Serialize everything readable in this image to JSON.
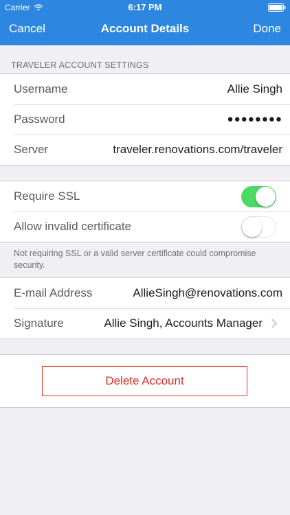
{
  "status_bar": {
    "carrier": "Carrier",
    "time": "6:17 PM"
  },
  "nav": {
    "cancel_label": "Cancel",
    "title": "Account Details",
    "done_label": "Done"
  },
  "traveler_section": {
    "header": "TRAVELER ACCOUNT SETTINGS",
    "rows": [
      {
        "label": "Username",
        "value": "Allie Singh"
      },
      {
        "label": "Password",
        "value": "●●●●●●●●"
      },
      {
        "label": "Server",
        "value": "traveler.renovations.com/traveler"
      }
    ]
  },
  "ssl_section": {
    "require_ssl": {
      "label": "Require SSL",
      "on": true
    },
    "allow_invalid": {
      "label": "Allow invalid certificate",
      "on": false
    },
    "footer": "Not requiring SSL or a valid server certificate could compromise security."
  },
  "mail_section": {
    "email": {
      "label": "E-mail Address",
      "value": "AllieSingh@renovations.com"
    },
    "signature": {
      "label": "Signature",
      "value": "Allie Singh, Accounts Manager"
    }
  },
  "delete_label": "Delete Account",
  "colors": {
    "nav_blue": "#2d87e0",
    "toggle_on": "#4cd964",
    "destructive_red": "#e0302a",
    "background": "#efeff4"
  },
  "icons": [
    "wifi-icon",
    "battery-icon",
    "chevron-right-icon"
  ]
}
